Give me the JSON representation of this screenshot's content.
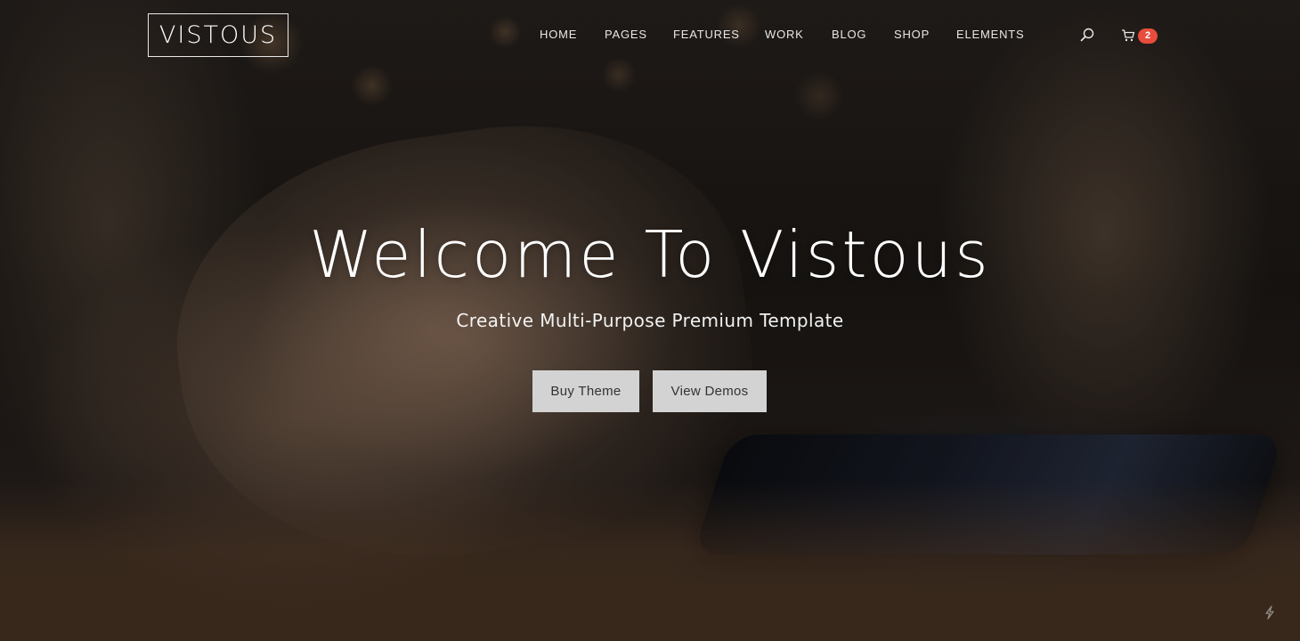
{
  "header": {
    "logo": "VISTOUS",
    "nav": [
      {
        "label": "HOME"
      },
      {
        "label": "PAGES"
      },
      {
        "label": "FEATURES"
      },
      {
        "label": "WORK"
      },
      {
        "label": "BLOG"
      },
      {
        "label": "SHOP"
      },
      {
        "label": "ELEMENTS"
      }
    ],
    "search_icon": "search-icon",
    "cart": {
      "icon": "shopping-cart-icon",
      "count": "2",
      "badge_color": "#e74c3c"
    }
  },
  "hero": {
    "title": "Welcome To Vistous",
    "subtitle": "Creative Multi-Purpose Premium Template",
    "buttons": {
      "primary": "Buy Theme",
      "secondary": "View Demos"
    },
    "button_color": "#d3d3d3"
  },
  "corner_icon": "lightning-icon"
}
